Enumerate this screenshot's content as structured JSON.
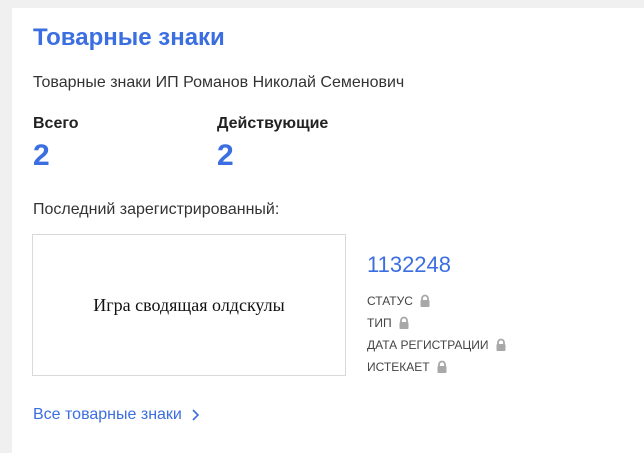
{
  "card": {
    "title": "Товарные знаки",
    "subtitle": "Товарные знаки ИП Романов Николай Семенович"
  },
  "stats": {
    "total_label": "Всего",
    "total_value": "2",
    "active_label": "Действующие",
    "active_value": "2"
  },
  "last_registered": {
    "label": "Последний зарегистрированный:",
    "image_text": "Игра сводящая олдскулы",
    "number": "1132248",
    "fields": [
      {
        "label": "СТАТУС",
        "icon": "lock-icon"
      },
      {
        "label": "ТИП",
        "icon": "lock-icon"
      },
      {
        "label": "ДАТА РЕГИСТРАЦИИ",
        "icon": "lock-icon"
      },
      {
        "label": "ИСТЕКАЕТ",
        "icon": "lock-icon"
      }
    ]
  },
  "footer": {
    "all_link": "Все товарные знаки",
    "icon": "chevron-right-icon"
  },
  "colors": {
    "accent": "#3b6ee0",
    "lock": "#a8a8a8"
  }
}
